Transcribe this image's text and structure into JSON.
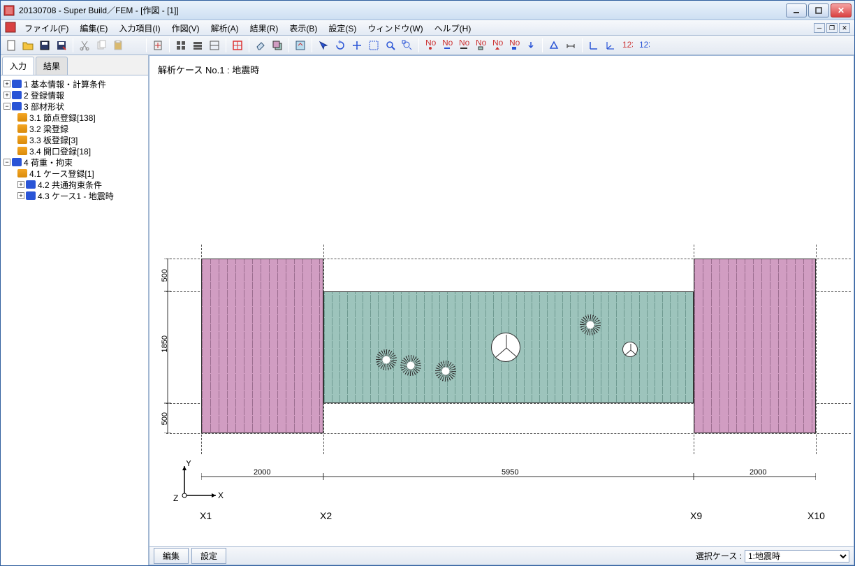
{
  "window": {
    "title": "20130708 - Super Build／FEM - [作図 - [1]]"
  },
  "menu": {
    "file": "ファイル(F)",
    "edit": "編集(E)",
    "input": "入力項目(I)",
    "draw": "作図(V)",
    "analysis": "解析(A)",
    "result": "結果(R)",
    "view": "表示(B)",
    "settings": "設定(S)",
    "window_m": "ウィンドウ(W)",
    "help": "ヘルプ(H)"
  },
  "left_tabs": {
    "input": "入力",
    "result": "結果"
  },
  "tree": {
    "n1": "1 基本情報・計算条件",
    "n2": "2 登録情報",
    "n3": "3 部材形状",
    "n31": "3.1 節点登録[138]",
    "n32": "3.2 梁登録",
    "n33": "3.3 板登録[3]",
    "n34": "3.4 開口登録[18]",
    "n4": "4 荷重・拘束",
    "n41": "4.1 ケース登録[1]",
    "n42": "4.2 共通拘束条件",
    "n43": "4.3 ケース1 - 地震時"
  },
  "viewport": {
    "title": "解析ケース No.1 : 地震時",
    "dims_h": [
      "2000",
      "5950",
      "2000"
    ],
    "dims_v_top": "500",
    "dims_v_mid": "1850",
    "dims_v_bot": "500",
    "axis_x": [
      "X1",
      "X2",
      "X9",
      "X10"
    ],
    "coord_x": "X",
    "coord_y": "Y",
    "coord_z": "Z"
  },
  "bottombar": {
    "edit_btn": "編集",
    "settings_btn": "設定",
    "select_case_lbl": "選択ケース :",
    "select_case_val": "1:地震時"
  }
}
